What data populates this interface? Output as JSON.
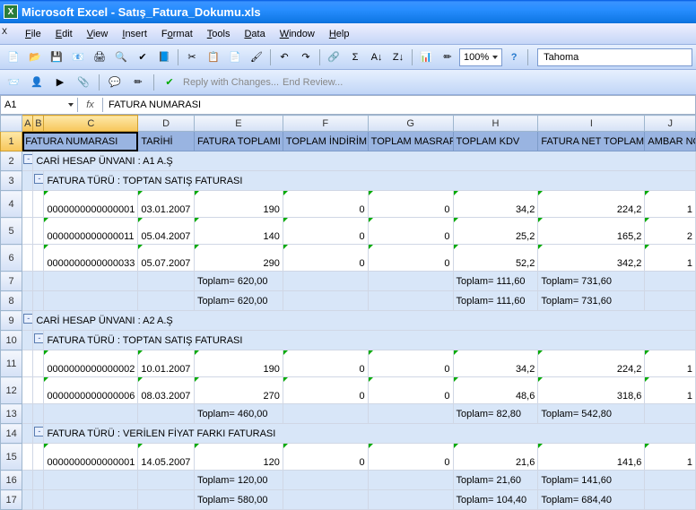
{
  "title": "Microsoft Excel - Satış_Fatura_Dokumu.xls",
  "menus": {
    "file": "File",
    "edit": "Edit",
    "view": "View",
    "insert": "Insert",
    "format": "Format",
    "tools": "Tools",
    "data": "Data",
    "window": "Window",
    "help": "Help"
  },
  "zoom": "100%",
  "font": "Tahoma",
  "reply": "Reply with Changes...",
  "endrev": "End Review...",
  "namebox": "A1",
  "fx": "fx",
  "formula": "FATURA NUMARASI",
  "columns": {
    "A": "A",
    "B": "B",
    "C": "C",
    "D": "D",
    "E": "E",
    "F": "F",
    "G": "G",
    "H": "H",
    "I": "I",
    "J": "J"
  },
  "headers": {
    "c": "FATURA NUMARASI",
    "d": "TARİHİ",
    "e": "FATURA TOPLAMI",
    "f": "TOPLAM İNDİRİM",
    "g": "TOPLAM MASRAF",
    "h": "TOPLAM KDV",
    "i": "FATURA NET TOPLAMI",
    "j": "AMBAR NO"
  },
  "rows": {
    "2": {
      "label": "CARİ HESAP ÜNVANI : A1 A.Ş"
    },
    "3": {
      "label": "FATURA TÜRÜ : TOPTAN SATIŞ FATURASI"
    },
    "4": {
      "c": "0000000000000001",
      "d": "03.01.2007",
      "e": "190",
      "f": "0",
      "g": "0",
      "h": "34,2",
      "i": "224,2",
      "j": "1"
    },
    "5": {
      "c": "0000000000000011",
      "d": "05.04.2007",
      "e": "140",
      "f": "0",
      "g": "0",
      "h": "25,2",
      "i": "165,2",
      "j": "2"
    },
    "6": {
      "c": "0000000000000033",
      "d": "05.07.2007",
      "e": "290",
      "f": "0",
      "g": "0",
      "h": "52,2",
      "i": "342,2",
      "j": "1"
    },
    "7": {
      "e": "Toplam= 620,00",
      "h": "Toplam= 111,60",
      "i": "Toplam= 731,60"
    },
    "8": {
      "e": "Toplam= 620,00",
      "h": "Toplam= 111,60",
      "i": "Toplam= 731,60"
    },
    "9": {
      "label": "CARİ HESAP ÜNVANI : A2 A.Ş"
    },
    "10": {
      "label": "FATURA TÜRÜ : TOPTAN SATIŞ FATURASI"
    },
    "11": {
      "c": "0000000000000002",
      "d": "10.01.2007",
      "e": "190",
      "f": "0",
      "g": "0",
      "h": "34,2",
      "i": "224,2",
      "j": "1"
    },
    "12": {
      "c": "0000000000000006",
      "d": "08.03.2007",
      "e": "270",
      "f": "0",
      "g": "0",
      "h": "48,6",
      "i": "318,6",
      "j": "1"
    },
    "13": {
      "e": "Toplam= 460,00",
      "h": "Toplam= 82,80",
      "i": "Toplam= 542,80"
    },
    "14": {
      "label": "FATURA TÜRÜ : VERİLEN FİYAT FARKI FATURASI"
    },
    "15": {
      "c": "0000000000000001",
      "d": "14.05.2007",
      "e": "120",
      "f": "0",
      "g": "0",
      "h": "21,6",
      "i": "141,6",
      "j": "1"
    },
    "16": {
      "e": "Toplam= 120,00",
      "h": "Toplam= 21,60",
      "i": "Toplam= 141,60"
    },
    "17": {
      "e": "Toplam= 580,00",
      "h": "Toplam= 104,40",
      "i": "Toplam= 684,40"
    }
  }
}
